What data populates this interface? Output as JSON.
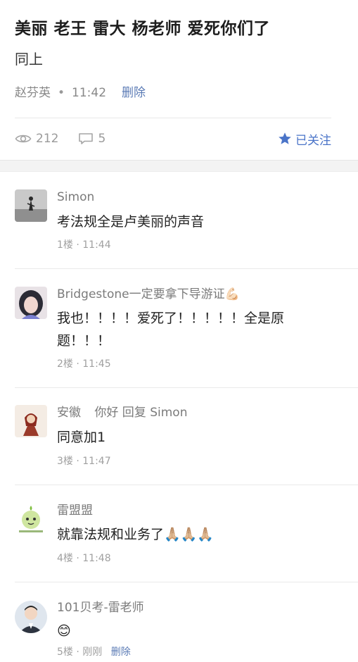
{
  "post": {
    "title": "美丽 老王 雷大 杨老师 爱死你们了",
    "body": "同上",
    "author": "赵芬英",
    "dot": "•",
    "time": "11:42",
    "delete_label": "删除"
  },
  "stats": {
    "views": "212",
    "comments": "5",
    "follow_label": "已关注",
    "accent_color": "#4a74c8"
  },
  "comments": [
    {
      "name": "Simon",
      "text": "考法规全是卢美丽的声音",
      "floor": "1楼 · 11:44"
    },
    {
      "name": "Bridgestone一定要拿下导游证💪🏻",
      "text": "我也！！！！爱死了！！！！！全是原题！！！",
      "floor": "2楼 · 11:45"
    },
    {
      "name": "安徽",
      "reply_text": "你好 回复 Simon",
      "text": "同意加1",
      "floor": "3楼 · 11:47"
    },
    {
      "name": "雷盟盟",
      "text": "就靠法规和业务了🙏🏼🙏🏼🙏🏼",
      "floor": "4楼 · 11:48"
    },
    {
      "name": "101贝考-雷老师",
      "text": "😊",
      "floor": "5楼 · 刚刚",
      "delete_label": "删除"
    }
  ]
}
